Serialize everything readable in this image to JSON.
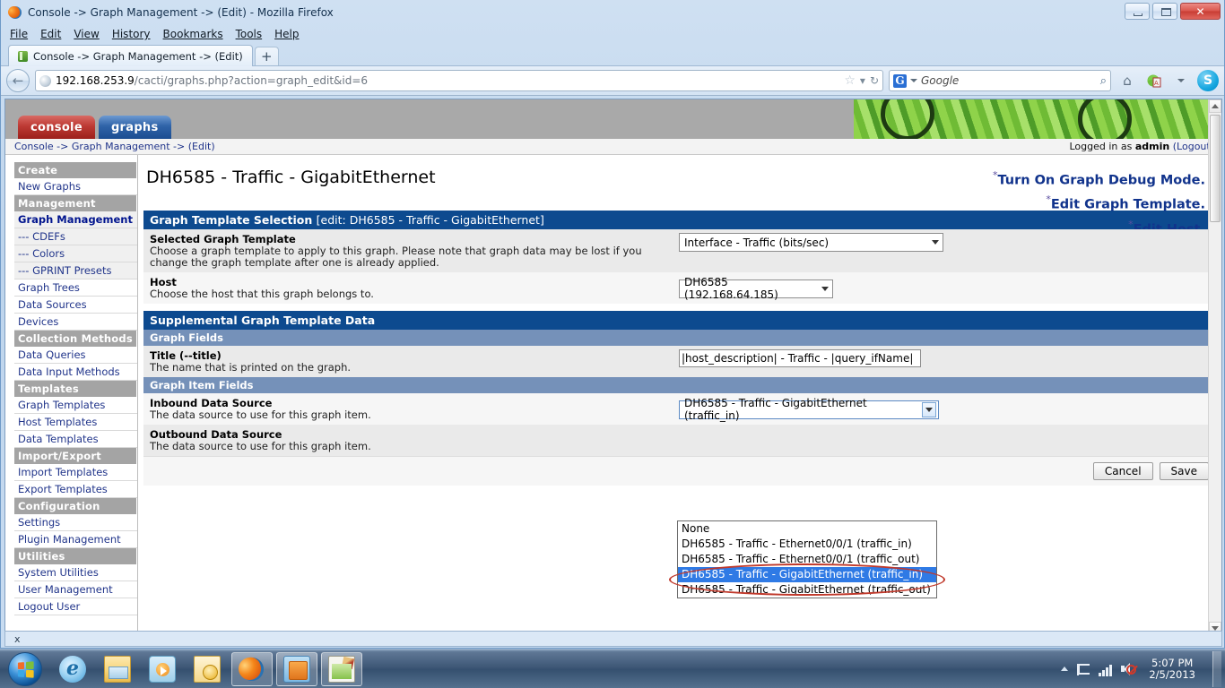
{
  "window": {
    "title": "Console -> Graph Management -> (Edit) - Mozilla Firefox",
    "minimize_label": "–",
    "maximize_label": "❐",
    "close_label": "✕"
  },
  "menubar": {
    "items": [
      "File",
      "Edit",
      "View",
      "History",
      "Bookmarks",
      "Tools",
      "Help"
    ]
  },
  "tabs": {
    "items": [
      {
        "label": "Console -> Graph Management -> (Edit)"
      }
    ],
    "new_tab_label": "+"
  },
  "navbar": {
    "back_label": "←",
    "url_host": "192.168.253.9",
    "url_path": "/cacti/graphs.php?action=graph_edit&id=6",
    "star_label": "☆",
    "dropmarker_label": "▾",
    "reload_label": "↻",
    "search_engine": "G",
    "search_placeholder": "Google",
    "search_value": "",
    "magnifier_label": "⌕",
    "home_label": "⌂",
    "skype_label": "S"
  },
  "cacti": {
    "tabs": [
      {
        "label": "console",
        "name": "console"
      },
      {
        "label": "graphs",
        "name": "graphs"
      }
    ],
    "breadcrumb": "Console -> Graph Management -> (Edit)",
    "login_prefix": "Logged in as ",
    "login_user": "admin",
    "login_logout": "(Logout)"
  },
  "sidebar": {
    "items": [
      {
        "label": "Create",
        "type": "head"
      },
      {
        "label": "New Graphs",
        "type": "item"
      },
      {
        "label": "Management",
        "type": "head"
      },
      {
        "label": "Graph Management",
        "type": "current"
      },
      {
        "label": "--- CDEFs",
        "type": "sub"
      },
      {
        "label": "--- Colors",
        "type": "sub"
      },
      {
        "label": "--- GPRINT Presets",
        "type": "sub"
      },
      {
        "label": "Graph Trees",
        "type": "item"
      },
      {
        "label": "Data Sources",
        "type": "item"
      },
      {
        "label": "Devices",
        "type": "item"
      },
      {
        "label": "Collection Methods",
        "type": "head"
      },
      {
        "label": "Data Queries",
        "type": "item"
      },
      {
        "label": "Data Input Methods",
        "type": "item"
      },
      {
        "label": "Templates",
        "type": "head"
      },
      {
        "label": "Graph Templates",
        "type": "item"
      },
      {
        "label": "Host Templates",
        "type": "item"
      },
      {
        "label": "Data Templates",
        "type": "item"
      },
      {
        "label": "Import/Export",
        "type": "head"
      },
      {
        "label": "Import Templates",
        "type": "item"
      },
      {
        "label": "Export Templates",
        "type": "item"
      },
      {
        "label": "Configuration",
        "type": "head"
      },
      {
        "label": "Settings",
        "type": "item"
      },
      {
        "label": "Plugin Management",
        "type": "item"
      },
      {
        "label": "Utilities",
        "type": "head"
      },
      {
        "label": "System Utilities",
        "type": "item"
      },
      {
        "label": "User Management",
        "type": "item"
      },
      {
        "label": "Logout User",
        "type": "item"
      }
    ]
  },
  "main": {
    "page_title": "DH6585 - Traffic - GigabitEthernet",
    "debug_links": [
      "Turn On Graph Debug Mode.",
      "Edit Graph Template.",
      "Edit Host."
    ],
    "asterisk": "*",
    "section1": {
      "title": "Graph Template Selection",
      "subtitle": "[edit: DH6585 - Traffic - GigabitEthernet]",
      "rows": [
        {
          "label": "Selected Graph Template",
          "desc": "Choose a graph template to apply to this graph. Please note that graph data may be lost if you change the graph template after one is already applied.",
          "value": "Interface - Traffic (bits/sec)"
        },
        {
          "label": "Host",
          "desc": "Choose the host that this graph belongs to.",
          "value": "DH6585 (192.168.64.185)"
        }
      ]
    },
    "section2": {
      "title": "Supplemental Graph Template Data",
      "graph_fields_title": "Graph Fields",
      "title_row": {
        "label": "Title (--title)",
        "desc": "The name that is printed on the graph.",
        "value": "|host_description| - Traffic - |query_ifName|"
      },
      "graph_item_fields_title": "Graph Item Fields",
      "inbound": {
        "label": "Inbound Data Source",
        "desc": "The data source to use for this graph item.",
        "value": "DH6585 - Traffic - GigabitEthernet (traffic_in)"
      },
      "outbound": {
        "label": "Outbound Data Source",
        "desc": "The data source to use for this graph item.",
        "value": ""
      }
    },
    "dropdown": {
      "open": true,
      "options": [
        {
          "label": "None",
          "selected": false
        },
        {
          "label": "DH6585 - Traffic - Ethernet0/0/1 (traffic_in)",
          "selected": false
        },
        {
          "label": "DH6585 - Traffic - Ethernet0/0/1 (traffic_out)",
          "selected": false
        },
        {
          "label": "DH6585 - Traffic - GigabitEthernet (traffic_in)",
          "selected": true
        },
        {
          "label": "DH6585 - Traffic - GigabitEthernet (traffic_out)",
          "selected": false
        }
      ],
      "highlight_color": "#2f7ae5",
      "annotation_color": "#c0392b"
    },
    "buttons": {
      "cancel": "Cancel",
      "save": "Save"
    }
  },
  "findbar": {
    "close_label": "x"
  },
  "taskbar": {
    "start_label": "Start",
    "tasks": [
      {
        "name": "internet-explorer",
        "active": false
      },
      {
        "name": "windows-explorer",
        "active": false
      },
      {
        "name": "windows-media-player",
        "active": false
      },
      {
        "name": "outlook",
        "active": false
      },
      {
        "name": "firefox",
        "active": true
      },
      {
        "name": "windows-explorer-2",
        "active": true
      },
      {
        "name": "notepadpp",
        "active": true
      }
    ],
    "tray": {
      "show_hidden_label": "▲",
      "time": "5:07 PM",
      "date": "2/5/2013"
    }
  }
}
